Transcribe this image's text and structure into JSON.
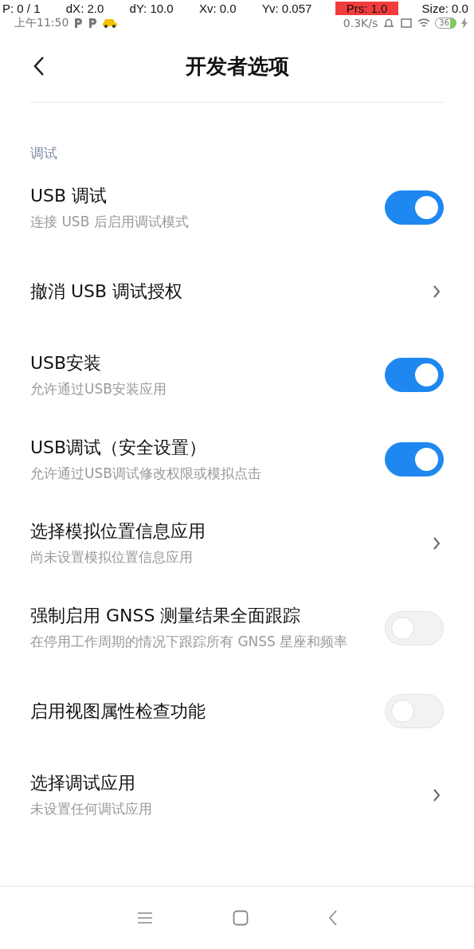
{
  "pointer_overlay": {
    "fields": [
      {
        "text": "P: 0 / 1",
        "highlighted": false
      },
      {
        "text": "dX: 2.0",
        "highlighted": false
      },
      {
        "text": "dY: 10.0",
        "highlighted": false
      },
      {
        "text": "Xv: 0.0",
        "highlighted": false
      },
      {
        "text": "Yv: 0.057",
        "highlighted": false
      },
      {
        "text": "Prs: 1.0",
        "highlighted": true
      },
      {
        "text": "Size: 0.0",
        "highlighted": false
      }
    ]
  },
  "status_bar": {
    "time": "上午11:50",
    "speed": "0.3K/s",
    "battery": "36"
  },
  "header": {
    "title": "开发者选项"
  },
  "section": {
    "title": "调试"
  },
  "settings": [
    {
      "kind": "toggle",
      "title": "USB 调试",
      "subtitle": "连接 USB 后启用调试模式",
      "on": true
    },
    {
      "kind": "link",
      "title": "撤消 USB 调试授权"
    },
    {
      "kind": "toggle",
      "title": "USB安装",
      "subtitle": "允许通过USB安装应用",
      "on": true
    },
    {
      "kind": "toggle",
      "title": "USB调试（安全设置）",
      "subtitle": "允许通过USB调试修改权限或模拟点击",
      "on": true
    },
    {
      "kind": "link",
      "title": "选择模拟位置信息应用",
      "subtitle": "尚未设置模拟位置信息应用"
    },
    {
      "kind": "toggle",
      "title": "强制启用 GNSS 测量结果全面跟踪",
      "subtitle": "在停用工作周期的情况下跟踪所有 GNSS 星座和频率",
      "on": false
    },
    {
      "kind": "toggle",
      "title": "启用视图属性检查功能",
      "on": false
    },
    {
      "kind": "link",
      "title": "选择调试应用",
      "subtitle": "未设置任何调试应用"
    }
  ]
}
